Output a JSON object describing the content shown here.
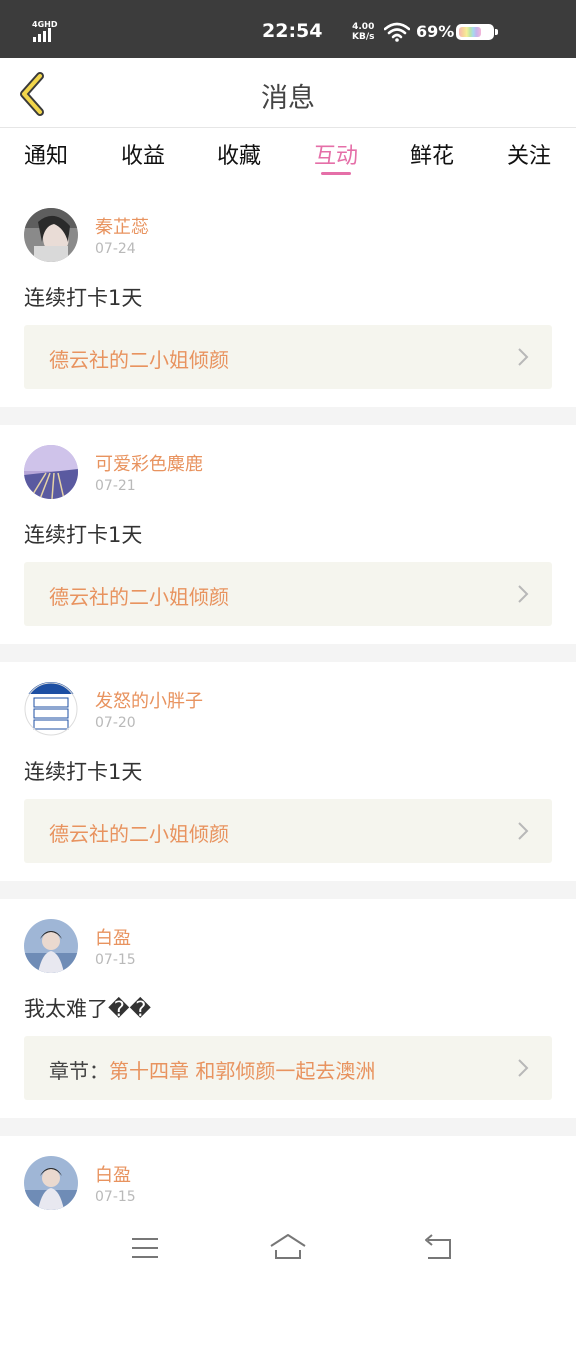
{
  "status_bar": {
    "network": "4GHD",
    "time": "22:54",
    "net_speed_value": "4.00",
    "net_speed_unit": "KB/s",
    "battery_percent": "69%",
    "battery_level": 0.69
  },
  "header": {
    "title": "消息"
  },
  "tabs": [
    {
      "label": "通知",
      "active": false
    },
    {
      "label": "收益",
      "active": false
    },
    {
      "label": "收藏",
      "active": false
    },
    {
      "label": "互动",
      "active": true
    },
    {
      "label": "鲜花",
      "active": false
    },
    {
      "label": "关注",
      "active": false
    }
  ],
  "colors": {
    "accent_tab": "#e56fa8",
    "username": "#e8935f",
    "reference_bg": "#f5f5ee"
  },
  "messages": [
    {
      "user": "秦芷蕊",
      "date": "07-24",
      "text": "连续打卡1天",
      "ref_prefix": "",
      "ref_title": "德云社的二小姐倾颜"
    },
    {
      "user": "可爱彩色麋鹿",
      "date": "07-21",
      "text": "连续打卡1天",
      "ref_prefix": "",
      "ref_title": "德云社的二小姐倾颜"
    },
    {
      "user": "发怒的小胖子",
      "date": "07-20",
      "text": "连续打卡1天",
      "ref_prefix": "",
      "ref_title": "德云社的二小姐倾颜"
    },
    {
      "user": "白盈",
      "date": "07-15",
      "text": "我太难了��",
      "ref_prefix": "章节：",
      "ref_title": "第十四章  和郭倾颜一起去澳洲"
    },
    {
      "user": "白盈",
      "date": "07-15",
      "text": "",
      "ref_prefix": "",
      "ref_title": ""
    }
  ],
  "icons": {
    "back": "chevron-left-icon",
    "menu": "menu-icon",
    "home": "home-icon",
    "return": "return-icon"
  }
}
